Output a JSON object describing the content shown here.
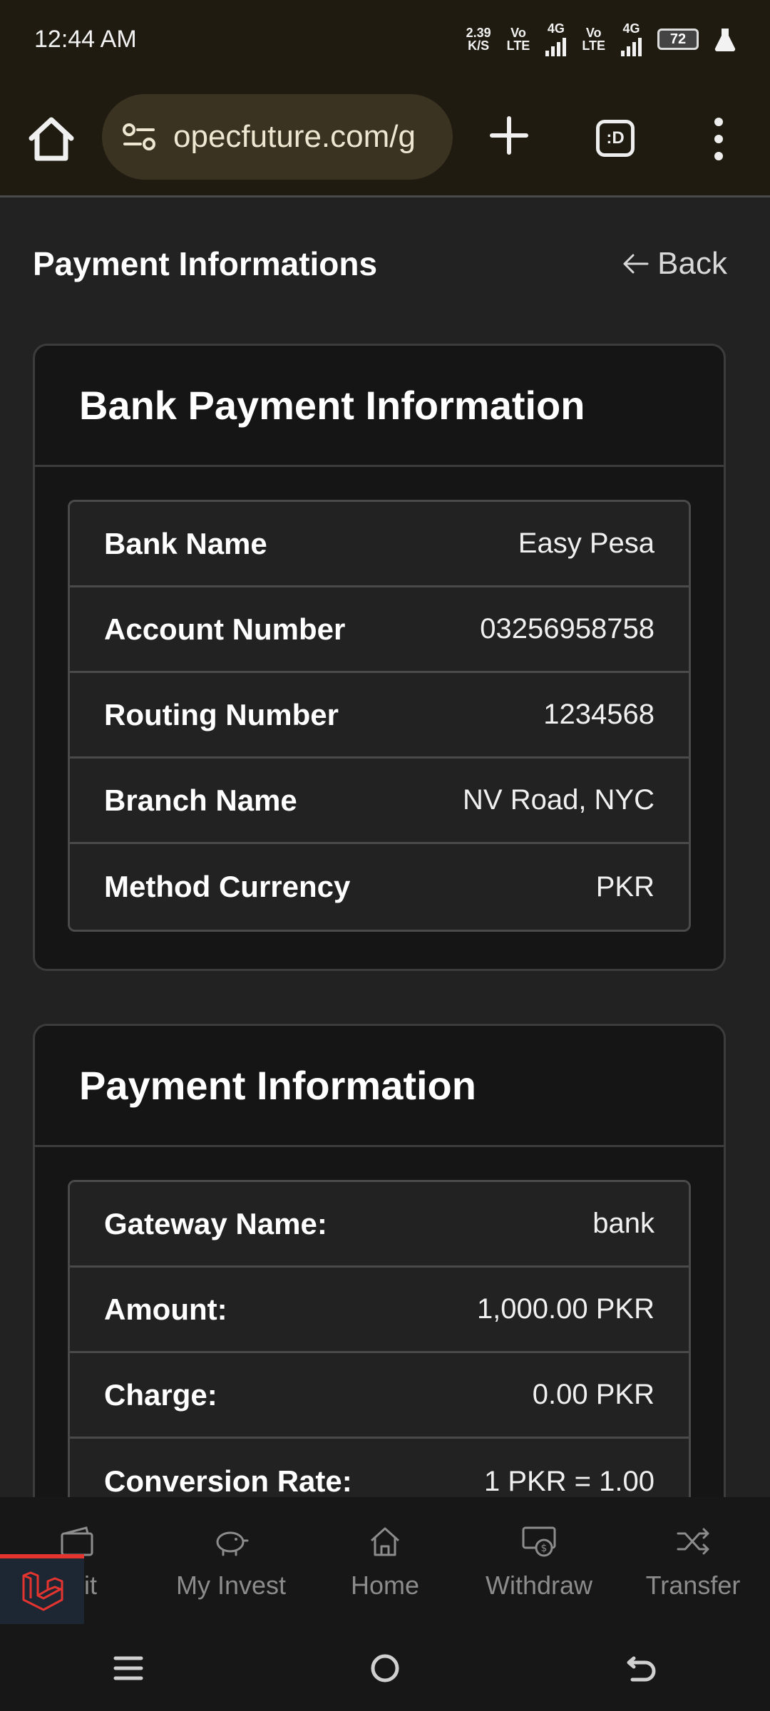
{
  "status_bar": {
    "time": "12:44 AM",
    "net_speed_value": "2.39",
    "net_speed_unit": "K/S",
    "volte1_top": "Vo",
    "volte1_bottom": "LTE",
    "net1": "4G",
    "volte2_top": "Vo",
    "volte2_bottom": "LTE",
    "net2": "4G",
    "battery": "72"
  },
  "browser": {
    "url": "opecfuture.com/g",
    "tab_switcher_label": ":D"
  },
  "page": {
    "title": "Payment Informations",
    "back_label": "Back"
  },
  "bank_card": {
    "title": "Bank Payment Information",
    "rows": [
      {
        "label": "Bank Name",
        "value": "Easy Pesa"
      },
      {
        "label": "Account Number",
        "value": "03256958758"
      },
      {
        "label": "Routing Number",
        "value": "1234568"
      },
      {
        "label": "Branch Name",
        "value": "NV Road, NYC"
      },
      {
        "label": "Method Currency",
        "value": "PKR"
      }
    ]
  },
  "payment_card": {
    "title": "Payment Information",
    "rows": [
      {
        "label": "Gateway Name:",
        "value": "bank"
      },
      {
        "label": "Amount:",
        "value": "1,000.00 PKR"
      },
      {
        "label": "Charge:",
        "value": "0.00 PKR"
      },
      {
        "label": "Conversion Rate:",
        "value": "1 PKR = 1.00"
      }
    ]
  },
  "bottom_nav": {
    "items": [
      {
        "label": "osit",
        "icon": "wallet-icon"
      },
      {
        "label": "My Invest",
        "icon": "piggy-bank-icon"
      },
      {
        "label": "Home",
        "icon": "home-icon"
      },
      {
        "label": "Withdraw",
        "icon": "cash-icon"
      },
      {
        "label": "Transfer",
        "icon": "shuffle-icon"
      }
    ]
  },
  "colors": {
    "page_bg": "#222222",
    "card_bg": "#151515",
    "browser_bar": "#1f1b10",
    "badge_accent": "#e3342f"
  }
}
